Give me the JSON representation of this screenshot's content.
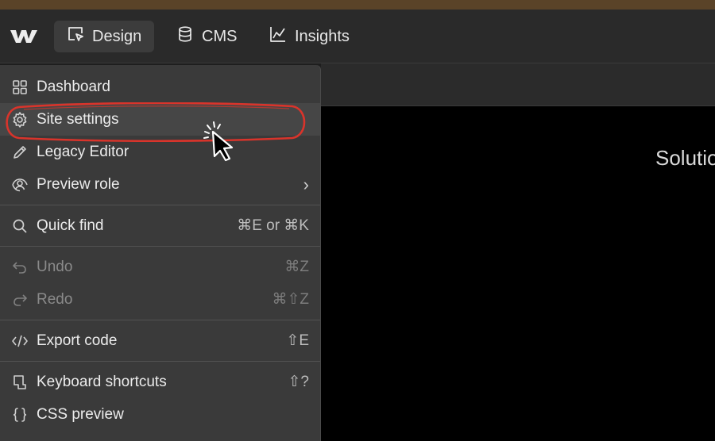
{
  "header": {
    "tabs": [
      {
        "label": "Design",
        "icon": "cursor-box-icon",
        "active": true
      },
      {
        "label": "CMS",
        "icon": "database-icon",
        "active": false
      },
      {
        "label": "Insights",
        "icon": "line-chart-icon",
        "active": false
      }
    ]
  },
  "canvas": {
    "text": "Solutio"
  },
  "menu": {
    "items": [
      {
        "label": "Dashboard",
        "icon": "grid-icon"
      },
      {
        "label": "Site settings",
        "icon": "gear-icon"
      },
      {
        "label": "Legacy Editor",
        "icon": "pencil-icon"
      },
      {
        "label": "Preview role",
        "icon": "preview-role-icon",
        "chevron": "›"
      },
      {
        "label": "Quick find",
        "icon": "search-icon",
        "shortcut": "⌘E or ⌘K"
      },
      {
        "label": "Undo",
        "icon": "undo-icon",
        "shortcut": "⌘Z"
      },
      {
        "label": "Redo",
        "icon": "redo-icon",
        "shortcut": "⌘⇧Z"
      },
      {
        "label": "Export code",
        "icon": "code-icon",
        "shortcut": "⇧E"
      },
      {
        "label": "Keyboard shortcuts",
        "icon": "keyboard-shortcut-icon",
        "shortcut": "⇧?"
      },
      {
        "label": "CSS preview",
        "icon": "braces-icon"
      }
    ]
  },
  "colors": {
    "menu_bg": "#3a3a3a",
    "highlight_red": "#d9342b",
    "top_strip": "#5a4328"
  }
}
